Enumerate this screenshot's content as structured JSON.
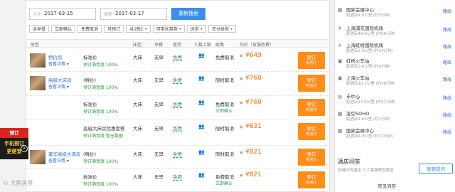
{
  "search": {
    "checkin_label": "入住",
    "checkin_value": "2017-03-15",
    "checkout_label": "退房",
    "checkout_value": "2017-03-17",
    "button": "重新搜索"
  },
  "filters": [
    {
      "label": "含早餐",
      "caret": false
    },
    {
      "label": "立即确认",
      "caret": false
    },
    {
      "label": "免费取消",
      "caret": false
    },
    {
      "label": "可预订",
      "caret": false
    },
    {
      "label": "共1晚1",
      "caret": true
    },
    {
      "label": "可用优惠券",
      "caret": true
    },
    {
      "label": "床型",
      "caret": true
    },
    {
      "label": "支付类型",
      "caret": true
    }
  ],
  "columns": {
    "room": "房型",
    "bed": "床型",
    "breakfast": "早餐",
    "wifi": "宽带",
    "people": "人数上限",
    "policy": "政策",
    "avg_price": "均价（含服务费）"
  },
  "rows": [
    {
      "room_name": "特价房",
      "room_detail": "查看详情 ▾",
      "plan": "标准价",
      "plan_sub": "预订满意度 100%",
      "bed": "大床",
      "breakfast": "无早",
      "wifi": "免费",
      "policy": "免费取消",
      "policy_sub": "",
      "price_old": "",
      "price": "¥649",
      "book": "预订",
      "book_sub": "到店付"
    },
    {
      "room_name": "高级大床房",
      "room_detail": "查看详情 ▾",
      "plan": "(特价)",
      "plan_sub": "预订满意度 100%",
      "bed": "大床",
      "breakfast": "无早",
      "wifi": "免费",
      "policy": "限时取消",
      "policy_sub": "",
      "price_old": "",
      "price": "¥760",
      "book": "预订",
      "book_sub": "到店付"
    },
    {
      "room_name": "",
      "room_detail": "",
      "plan": "标准价",
      "plan_sub": "预订满意度 100%",
      "bed": "大床",
      "breakfast": "无早",
      "wifi": "免费",
      "policy": "免费取消",
      "policy_sub": "立即确认",
      "price_old": "",
      "price": "¥760",
      "book": "预订",
      "book_sub": "到店付"
    },
    {
      "room_name": "",
      "room_detail": "",
      "plan": "高级大床房优惠套餐",
      "plan_sub": "预订满意度 暂无数据",
      "bed": "大床",
      "breakfast": "无早",
      "wifi": "免费",
      "policy": "限时取消",
      "policy_sub": "",
      "price_old": "",
      "price": "¥831",
      "book": "预订",
      "book_sub": "到店付"
    },
    {
      "room_name": "豪华高级大床房",
      "room_detail": "查看详情 ▾",
      "plan": "(特价)",
      "plan_sub": "预订满意度 100%",
      "bed": "大床",
      "breakfast": "无早",
      "wifi": "免费",
      "policy": "限时取消",
      "policy_sub": "",
      "price_old": "",
      "price": "¥821",
      "book": "预订",
      "book_sub": "到店付"
    },
    {
      "room_name": "",
      "room_detail": "",
      "plan": "标准价",
      "plan_sub": "预订满意度 100%",
      "bed": "大床",
      "breakfast": "无早",
      "wifi": "免费",
      "policy": "免费取消",
      "policy_sub": "立即确认",
      "price_old": "",
      "price": "¥821",
      "book": "预订",
      "book_sub": "到店付"
    }
  ],
  "pois": [
    {
      "icon": "building-icon",
      "name": "国家会展中心",
      "dist": "距酒店4.8公里 (约5分钟)",
      "link": "路线"
    },
    {
      "icon": "plane-icon",
      "name": "上海浦东国际机场",
      "dist": "距酒店44.6公里 (约56分钟)",
      "link": "路线"
    },
    {
      "icon": "plane-icon",
      "name": "上海虹桥国际机场",
      "dist": "距酒店2.4公里 (约14分钟)",
      "link": "路线"
    },
    {
      "icon": "train-icon",
      "name": "虹桥火车站",
      "dist": "距酒店3.8公里 (约8分钟)",
      "link": "路线"
    },
    {
      "icon": "train-icon",
      "name": "上海火车站",
      "dist": "距酒店18.1公里 (约38分钟)",
      "link": "路线"
    },
    {
      "icon": "city-icon",
      "name": "市中心",
      "dist": "距酒店17.6公里 (约41分钟)",
      "link": "路线"
    },
    {
      "icon": "building-icon",
      "name": "凌空SOHO",
      "dist": "距酒店1.6公里 (约1分钟)",
      "link": "路线"
    },
    {
      "icon": "building-icon",
      "name": "国家会展中心",
      "dist": "距酒店4.9公里 (约17分钟)",
      "link": "路线"
    }
  ],
  "qa": {
    "title": "酒店问答",
    "desc": "有疑问找酒店,人工客服帮您解答",
    "button": "我要提问",
    "common": "常见问答"
  },
  "promo": {
    "ribbon": "预订",
    "line1": "手机预订",
    "line2": "更便宜",
    "close": "×"
  },
  "watermark": "© 大鹏美景"
}
